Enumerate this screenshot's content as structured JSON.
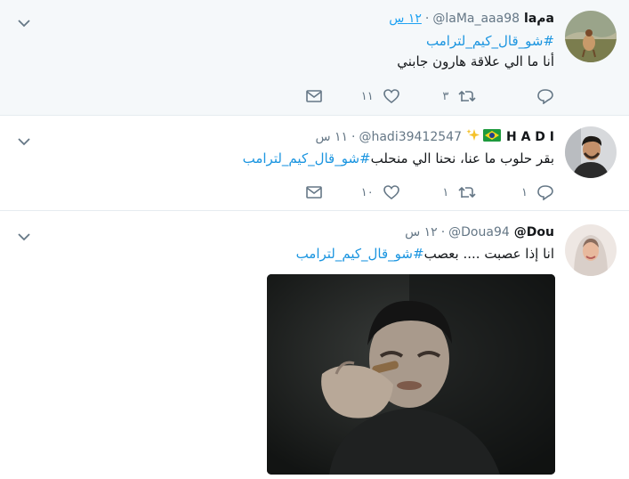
{
  "tweets": [
    {
      "name": "aمla",
      "handle": "@laMa_aaa98",
      "time": "١٢ س",
      "hashtag": "#شو_قال_كيم_لترامب",
      "text": "أنا ما الي علاقة هارون جابني",
      "replies": "",
      "retweets": "٣",
      "likes": "١١"
    },
    {
      "name": "H A D I",
      "handle": "@hadi39412547",
      "time": "١١ س",
      "hashtag": "#شو_قال_كيم_لترامب",
      "text": " بقر حلوب ما عنا، نحنا الي منحلب",
      "replies": "١",
      "retweets": "١",
      "likes": "١٠"
    },
    {
      "name": "Dou@",
      "handle": "@Doua94",
      "time": "١٢ س",
      "hashtag": "#شو_قال_كيم_لترامب",
      "text": " انا إذا عصبت .... بعصب",
      "replies": "",
      "retweets": "",
      "likes": ""
    }
  ],
  "icons": [
    "chevron-down-icon",
    "reply-icon",
    "retweet-icon",
    "like-icon",
    "message-icon",
    "brazil-flag-icon",
    "sparkles-icon"
  ],
  "colors": {
    "accent": "#1da1f2",
    "hashtag": "#1b95e0",
    "muted": "#657786",
    "highlight_bg": "#f5f8fa"
  }
}
